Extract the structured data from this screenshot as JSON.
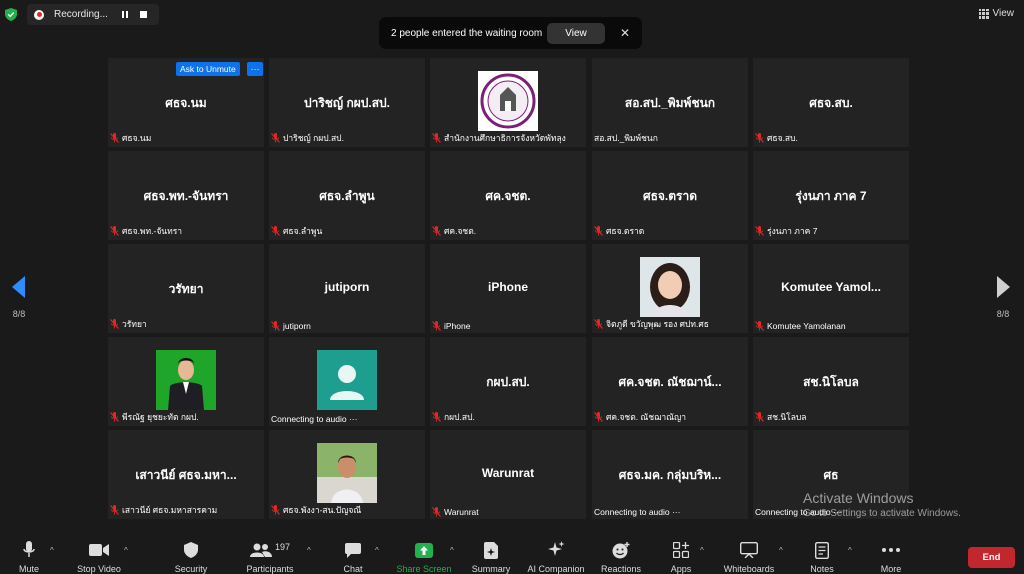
{
  "top": {
    "recording_label": "Recording...",
    "notification_text": "2 people entered the waiting room",
    "notification_view": "View",
    "notification_close": "✕",
    "view_label": "View"
  },
  "tile_actions": {
    "ask_unmute": "Ask to Unmute",
    "more": "···"
  },
  "tiles": [
    {
      "name": "ศธจ.นม",
      "label": "ศธจ.นม",
      "muted": true
    },
    {
      "name": "ปาริชญ์ กผป.สป.",
      "label": "ปาริชญ์ กผป.สป.",
      "muted": true
    },
    {
      "name": "",
      "label": "สำนักงานศึกษาธิการจังหวัดพัทลุง",
      "muted": true,
      "photo": "logo"
    },
    {
      "name": "สอ.สป._พิมพ์ชนก",
      "label": "สอ.สป._พิมพ์ชนก",
      "muted": false
    },
    {
      "name": "ศธจ.สบ.",
      "label": "ศธจ.สบ.",
      "muted": true
    },
    {
      "name": "ศธจ.พท.-จันทรา",
      "label": "ศธจ.พท.-จันทรา",
      "muted": true
    },
    {
      "name": "ศธจ.ลำพูน",
      "label": "ศธจ.ลำพูน",
      "muted": true
    },
    {
      "name": "ศค.จชต.",
      "label": "ศค.จชต.",
      "muted": true
    },
    {
      "name": "ศธจ.ตราด",
      "label": "ศธจ.ตราด",
      "muted": true
    },
    {
      "name": "รุ่งนภา ภาค 7",
      "label": "รุ่งนภา ภาค 7",
      "muted": true
    },
    {
      "name": "วรัทยา",
      "label": "วรัทยา",
      "muted": true
    },
    {
      "name": "jutiporn",
      "label": "jutiporn",
      "muted": true
    },
    {
      "name": "iPhone",
      "label": "iPhone",
      "muted": true
    },
    {
      "name": "",
      "label": "จิตภูดี ขวัญพุฒ รอง ศปท.ศธ",
      "muted": true,
      "photo": "woman"
    },
    {
      "name": "Komutee Yamol...",
      "label": "Komutee Yamolanan",
      "muted": true
    },
    {
      "name": "",
      "label": "พีรณัฐ ยุชยะทัต กผป.",
      "muted": true,
      "photo": "man-green"
    },
    {
      "name": "",
      "label": "Connecting to audio ···",
      "muted": false,
      "photo": "avatar"
    },
    {
      "name": "กผป.สป.",
      "label": "กผป.สป.",
      "muted": true
    },
    {
      "name": "ศค.จชต. ณัชฌาน์...",
      "label": "ศค.จชต. ณัชฌาณัญา",
      "muted": true
    },
    {
      "name": "สช.นิโลบล",
      "label": "สช.นิโลบล",
      "muted": true
    },
    {
      "name": "เสาวนีย์ ศธจ.มหา...",
      "label": "เสาวนีย์ ศธจ.มหาสารคาม",
      "muted": true
    },
    {
      "name": "",
      "label": "ศธจ.พังงา-สน.ปัญจณี",
      "muted": true,
      "photo": "woman2"
    },
    {
      "name": "Warunrat",
      "label": "Warunrat",
      "muted": true
    },
    {
      "name": "ศธจ.มค. กลุ่มบริห...",
      "label": "Connecting to audio ···",
      "muted": false
    },
    {
      "name": "ศธ",
      "label": "Connecting to audio ···",
      "muted": false
    }
  ],
  "pagination": {
    "left": "8/8",
    "right": "8/8"
  },
  "watermark": {
    "title": "Activate Windows",
    "subtitle": "Go to Settings to activate Windows."
  },
  "toolbar": {
    "mute": "Mute",
    "stop_video": "Stop Video",
    "security": "Security",
    "participants": "Participants",
    "participants_count": "197",
    "chat": "Chat",
    "share_screen": "Share Screen",
    "summary": "Summary",
    "ai_companion": "AI Companion",
    "reactions": "Reactions",
    "apps": "Apps",
    "whiteboards": "Whiteboards",
    "notes": "Notes",
    "more": "More",
    "end": "End"
  },
  "colors": {
    "accent_blue": "#0e72ed",
    "share_green": "#23b14d",
    "end_red": "#c3272e",
    "mute_red": "#e02828"
  }
}
